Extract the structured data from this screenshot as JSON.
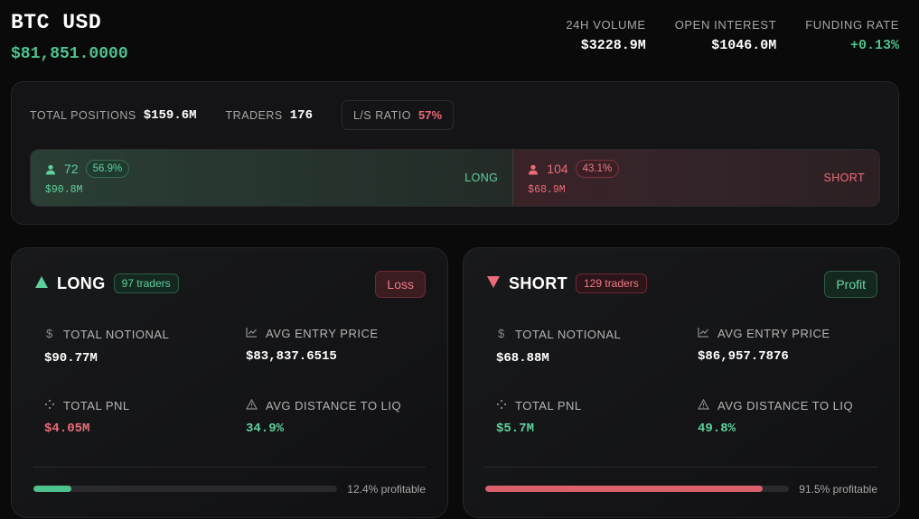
{
  "header": {
    "title": "BTC USD",
    "price": "$81,851.0000",
    "stats": [
      {
        "label": "24H VOLUME",
        "value": "$3228.9M"
      },
      {
        "label": "OPEN INTEREST",
        "value": "$1046.0M"
      },
      {
        "label": "FUNDING RATE",
        "value": "+0.13%"
      }
    ]
  },
  "overview": {
    "total_positions_label": "TOTAL POSITIONS",
    "total_positions_value": "$159.6M",
    "traders_label": "TRADERS",
    "traders_value": "176",
    "ls_ratio_label": "L/S RATIO",
    "ls_ratio_value": "57%",
    "long": {
      "count": "72",
      "pct": "56.9%",
      "amount": "$90.8M",
      "side": "LONG",
      "share": 0.569
    },
    "short": {
      "count": "104",
      "pct": "43.1%",
      "amount": "$68.9M",
      "side": "SHORT"
    }
  },
  "cards": {
    "long": {
      "title": "LONG",
      "traders": "97 traders",
      "status": "Loss",
      "total_notional_label": "TOTAL NOTIONAL",
      "total_notional": "$90.77M",
      "avg_entry_label": "AVG ENTRY PRICE",
      "avg_entry": "$83,837.6515",
      "total_pnl_label": "TOTAL PNL",
      "total_pnl": "$4.05M",
      "avg_dist_label": "AVG DISTANCE TO LIQ",
      "avg_dist": "34.9%",
      "profitable_text": "12.4% profitable",
      "profitable_fraction": 0.124
    },
    "short": {
      "title": "SHORT",
      "traders": "129 traders",
      "status": "Profit",
      "total_notional_label": "TOTAL NOTIONAL",
      "total_notional": "$68.88M",
      "avg_entry_label": "AVG ENTRY PRICE",
      "avg_entry": "$86,957.7876",
      "total_pnl_label": "TOTAL PNL",
      "total_pnl": "$5.7M",
      "avg_dist_label": "AVG DISTANCE TO LIQ",
      "avg_dist": "49.8%",
      "profitable_text": "91.5% profitable",
      "profitable_fraction": 0.915
    }
  },
  "colors": {
    "green": "#4fc38e",
    "red": "#d9606c"
  },
  "icons": [
    "user-icon",
    "dollar-icon",
    "trend-chart-icon",
    "sparkle-icon",
    "warning-triangle-icon",
    "triangle-up-icon",
    "triangle-down-icon"
  ]
}
